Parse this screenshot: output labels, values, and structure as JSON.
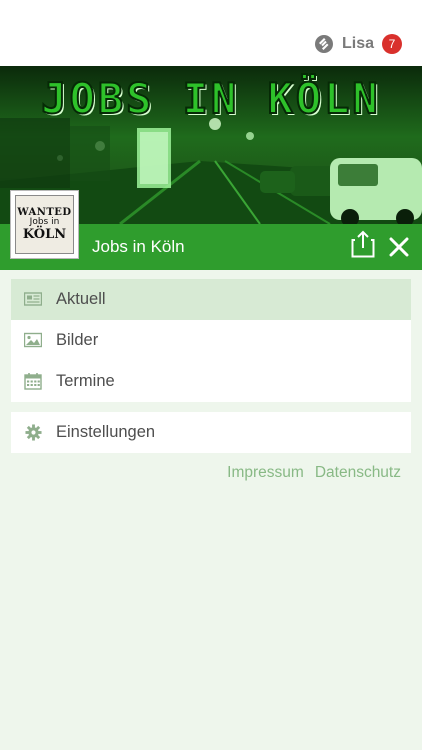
{
  "topbar": {
    "user_name": "Lisa",
    "badge_count": "7",
    "user_icon": "user-icon"
  },
  "banner": {
    "title": "JOBS IN KÖLN"
  },
  "logo": {
    "line1": "WANTED",
    "line2": "Jobs in",
    "line3": "KÖLN"
  },
  "header": {
    "title": "Jobs in Köln",
    "share_icon": "share-icon",
    "close_icon": "close-icon"
  },
  "menu": {
    "items": [
      {
        "label": "Aktuell",
        "icon": "news-icon",
        "active": true
      },
      {
        "label": "Bilder",
        "icon": "image-icon",
        "active": false
      },
      {
        "label": "Termine",
        "icon": "calendar-icon",
        "active": false
      }
    ],
    "settings": {
      "label": "Einstellungen",
      "icon": "gear-icon"
    }
  },
  "footer": {
    "impressum": "Impressum",
    "datenschutz": "Datenschutz"
  },
  "colors": {
    "accent": "#2f9d2d",
    "active_bg": "#d7ead4",
    "page_bg": "#eef6ec",
    "badge": "#d9302c",
    "link": "#88b985"
  }
}
